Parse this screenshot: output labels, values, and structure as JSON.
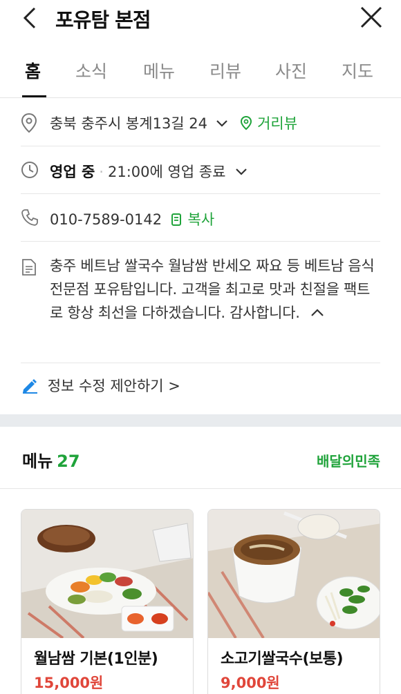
{
  "header": {
    "title": "포유탐 본점"
  },
  "tabs": [
    {
      "label": "홈",
      "active": true
    },
    {
      "label": "소식"
    },
    {
      "label": "메뉴"
    },
    {
      "label": "리뷰"
    },
    {
      "label": "사진"
    },
    {
      "label": "지도"
    }
  ],
  "info": {
    "address": "충북 충주시 봉계13길 24",
    "street_view": "거리뷰",
    "status": "영업 중",
    "hours": "21:00에 영업 종료",
    "phone": "010-7589-0142",
    "copy": "복사",
    "description": "충주 베트남 쌀국수 월남쌈 반세오 짜요 등 베트남 음식 전문점 포유탐입니다. 고객을 최고로 맛과 친절을 팩트로 항상 최선을 다하겠습니다. 감사합니다.",
    "suggest": "정보 수정 제안하기 >"
  },
  "menu": {
    "title": "메뉴",
    "count": "27",
    "link": "배달의민족",
    "items": [
      {
        "name": "월남쌈 기본(1인분)",
        "price": "15,000원"
      },
      {
        "name": "소고기쌀국수(보통)",
        "price": "9,000원"
      }
    ]
  },
  "colors": {
    "accent_green": "#1fa33a",
    "price_red": "#e0463a"
  }
}
